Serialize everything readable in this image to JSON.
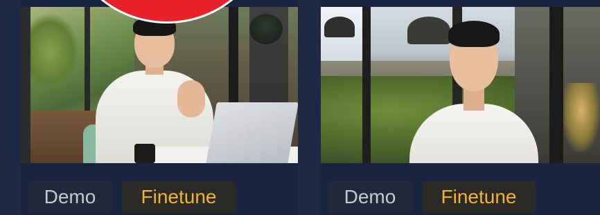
{
  "colors": {
    "page_background": "#1e2945",
    "card_background": "#1a2440",
    "demo_tag_bg": "#23283a",
    "demo_tag_text": "#c7c9d1",
    "finetune_tag_bg": "#2b2a26",
    "finetune_tag_text": "#f2b233",
    "overlay_red": "#e8212b"
  },
  "cards": [
    {
      "thumbnail": "man-seated-at-laptop-photo",
      "tags": [
        "Demo",
        "Finetune"
      ]
    },
    {
      "thumbnail": "man-head-and-shoulders-photo",
      "tags": [
        "Demo",
        "Finetune"
      ]
    }
  ]
}
